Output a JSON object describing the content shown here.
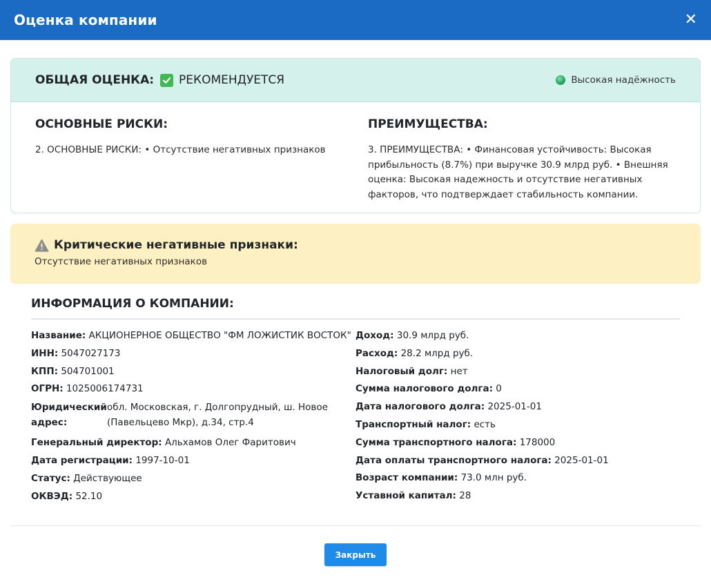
{
  "header": {
    "title": "Оценка компании",
    "close_symbol": "✕"
  },
  "assessment": {
    "overall_label": "ОБЩАЯ ОЦЕНКА:",
    "verdict": "РЕКОМЕНДУЕТСЯ",
    "reliability": "Высокая надёжность",
    "risks_title": "ОСНОВНЫЕ РИСКИ:",
    "risks_text": "2. ОСНОВНЫЕ РИСКИ: • Отсутствие негативных признаков",
    "advantages_title": "ПРЕИМУЩЕСТВА:",
    "advantages_text": "3. ПРЕИМУЩЕСТВА: • Финансовая устойчивость: Высокая прибыльность (8.7%) при выручке 30.9 млрд руб. • Внешняя оценка: Высокая надежность и отсутствие негативных факторов, что подтверждает стабильность компании.",
    "colors": {
      "check": "#3fb950",
      "reliability_dot": "#28a764",
      "top_bg": "#d4f1ec"
    }
  },
  "critical": {
    "title": "Критические негативные признаки:",
    "text": "Отсутствие негативных признаков",
    "colors": {
      "bg": "#fdf0c2",
      "icon": "#8d8d8d"
    }
  },
  "company_info": {
    "title": "ИНФОРМАЦИЯ О КОМПАНИИ:",
    "left": [
      {
        "key": "Название:",
        "value": "АКЦИОНЕРНОЕ ОБЩЕСТВО \"ФМ ЛОЖИСТИК ВОСТОК\""
      },
      {
        "key": "ИНН:",
        "value": "5047027173"
      },
      {
        "key": "КПП:",
        "value": "504701001"
      },
      {
        "key": "ОГРН:",
        "value": "1025006174731"
      },
      {
        "key": "Юридический адрес:",
        "value": "обл. Московская, г. Долгопрудный, ш. Новое (Павельцево Мкр), д.34, стр.4"
      },
      {
        "key": "Генеральный директор:",
        "value": "Альхамов Олег Фаритович"
      },
      {
        "key": "Дата регистрации:",
        "value": "1997-10-01"
      },
      {
        "key": "Статус:",
        "value": "Действующее"
      },
      {
        "key": "ОКВЭД:",
        "value": "52.10"
      }
    ],
    "right": [
      {
        "key": "Доход:",
        "value": "30.9 млрд руб."
      },
      {
        "key": "Расход:",
        "value": "28.2 млрд руб."
      },
      {
        "key": "Налоговый долг:",
        "value": "нет"
      },
      {
        "key": "Сумма налогового долга:",
        "value": "0"
      },
      {
        "key": "Дата налогового долга:",
        "value": "2025-01-01"
      },
      {
        "key": "Транспортный налог:",
        "value": "есть"
      },
      {
        "key": "Сумма транспортного налога:",
        "value": "178000"
      },
      {
        "key": "Дата оплаты транспортного налога:",
        "value": "2025-01-01"
      },
      {
        "key": "Возраст компании:",
        "value": "73.0 млн руб."
      },
      {
        "key": "Уставной капитал:",
        "value": "28"
      }
    ]
  },
  "footer": {
    "close_button": "Закрыть",
    "colors": {
      "header": "#1b6ac4",
      "button": "#1f8ae8"
    }
  }
}
